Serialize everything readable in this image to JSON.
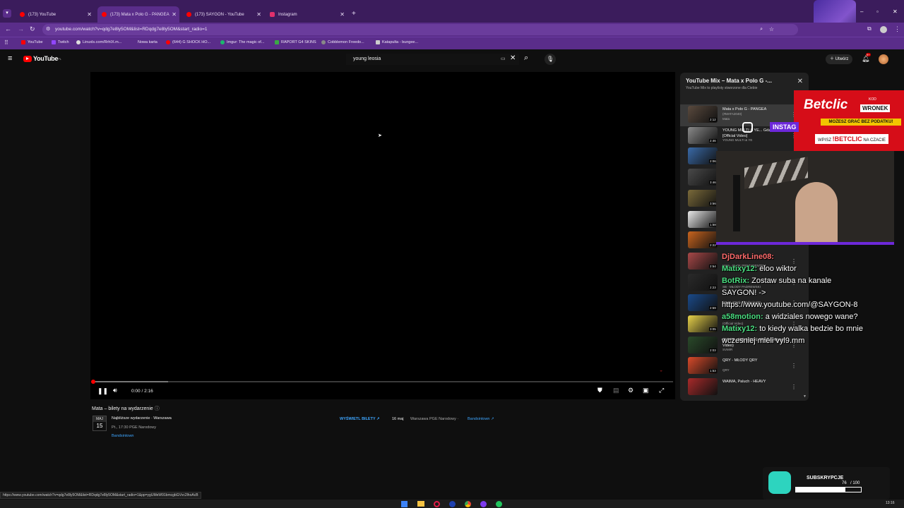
{
  "browser": {
    "tabs": [
      {
        "title": "(173) YouTube",
        "fav_color": "#ff0000"
      },
      {
        "title": "(173) Mata x Polo G - PANGEA",
        "fav_color": "#ff0000"
      },
      {
        "title": "(173) SAYGON - YouTube",
        "fav_color": "#ff0000"
      },
      {
        "title": "Instagram",
        "fav_color": "#e1306c"
      }
    ],
    "new_tab_label": "+",
    "url": "youtube.com/watch?v=qdg7e8ly5OM&list=RDqdg7e8ly5OM&start_radio=1",
    "bookmarks": [
      {
        "label": "YouTube",
        "color": "#ff0000"
      },
      {
        "label": "Twitch",
        "color": "#9146ff"
      },
      {
        "label": "Linuxls.com/RrhIX.m...",
        "color": "#dddddd"
      },
      {
        "label": "Nowa karta",
        "color": "#5a2d8a"
      },
      {
        "label": "(644) G SHOCK HO...",
        "color": "#ff0000"
      },
      {
        "label": "Imgur: The magic of...",
        "color": "#1bb76e"
      },
      {
        "label": "RAPORT G4 SKINS",
        "color": "#3aa845"
      },
      {
        "label": "Cobblemon Freedo...",
        "color": "#888888"
      },
      {
        "label": "Katapulta - bungee...",
        "color": "#cccccc"
      }
    ]
  },
  "youtube": {
    "logo_text": "YouTube",
    "logo_country": "PL",
    "search_value": "young leosia",
    "create_label": "Utwórz",
    "notif_count": "9+"
  },
  "player": {
    "time": "0:00 / 2:16",
    "progress": 0.0,
    "buffered": 0.13
  },
  "event": {
    "title": "Mata – bilety na wydarzenie",
    "month": "MAJ",
    "day": "15",
    "next_label": "Najbliższe wydarzenie · Warszawa",
    "next_detail": "Pt., 17:30 PGE Narodowy",
    "provider": "Bandsintown",
    "tickets_label": "WYŚWIETL BILETY",
    "row_date": "16 maj",
    "row_place": "Warszawa PGE Narodowy",
    "row_provider": "Bandsintown"
  },
  "playlist": {
    "title": "YouTube Mix – Mata x Polo G -...",
    "subtitle": "YouTube Mix to playlisty stworzone dla Ciebie",
    "items": [
      {
        "title": "Mata x Polo G - PANGEA",
        "sub": "(#MATA2040)",
        "author": "Mata",
        "dur": "2:12",
        "color": "#5a4a3e"
      },
      {
        "title": "YOUNG MULTI & YE... Gdzie dom? [Official Video]",
        "sub": "",
        "author": "YOUNG MULTI & YE",
        "dur": "2:46",
        "color": "#8a8a8a"
      },
      {
        "title": "",
        "sub": "",
        "author": "",
        "dur": "2:06",
        "color": "#3a6aa8"
      },
      {
        "title": "",
        "sub": "",
        "author": "",
        "dur": "3:46",
        "color": "#4a4a4a"
      },
      {
        "title": "",
        "sub": "",
        "author": "",
        "dur": "3:56",
        "color": "#7a6a3a"
      },
      {
        "title": "",
        "sub": "",
        "author": "",
        "dur": "1:58",
        "color": "#e8e8e8"
      },
      {
        "title": "",
        "sub": "",
        "author": "",
        "dur": "2:22",
        "color": "#c8641e"
      },
      {
        "title": "",
        "sub": "",
        "author": "Mata - BLOK PREZYDENTEM",
        "dur": "2:54",
        "color": "#a84848"
      },
      {
        "title": "",
        "sub": "",
        "author": "SB - MŁODY PADREWSKI",
        "dur": "2:23",
        "color": "#2a2a2a"
      },
      {
        "title": "",
        "sub": "(28.01.2022) #fundacja420",
        "author": "",
        "dur": "2:59",
        "color": "#1a4a8a"
      },
      {
        "title": "",
        "sub": "(Official Video)",
        "author": "Mata i Khaid",
        "dur": "3:05",
        "color": "#e8d24a"
      },
      {
        "title": "SVM!R - NIE MOGE SPAĆ (Official Video)",
        "sub": "",
        "author": "SVM!R",
        "dur": "2:03",
        "color": "#2a4a2a"
      },
      {
        "title": "QRY - MŁODY QRY",
        "sub": "",
        "author": "QRY",
        "dur": "1:53",
        "color": "#d84a2a"
      },
      {
        "title": "WAIMA, Paluch - HEAVY",
        "sub": "",
        "author": "",
        "dur": "",
        "color": "#a82a2a"
      }
    ]
  },
  "overlay": {
    "betclic_brand": "Betclic",
    "betclic_code_label": "KOD",
    "betclic_code": "WRONEK",
    "betclic_tagline": "MOŻESZ GRAĆ BEZ PODATKU!",
    "betclic_cta_prefix": "WPISZ",
    "betclic_cta_brand": "!BETCLIC",
    "betclic_cta_suffix": "NA CZACIE",
    "insta_label": "INSTAG",
    "chat": [
      {
        "user": "DjDarkLine08:",
        "msg": "",
        "color": "#ff6b6b"
      },
      {
        "user": "Matixy12:",
        "msg": "eloo wiktor",
        "color": "#4ade80"
      },
      {
        "user": "BotRix:",
        "msg": "Zostaw suba na kanale",
        "color": "#4ade80"
      },
      {
        "user": "",
        "msg": "SAYGON! ->",
        "color": "#ffffff"
      },
      {
        "user": "",
        "msg": "https://www.youtube.com/@SAYGON-8",
        "color": "#ffffff"
      },
      {
        "user": "a58motion:",
        "msg": "a widziales nowego wane?",
        "color": "#4ade80"
      },
      {
        "user": "Matixy12:",
        "msg": "to kiedy walka bedzie bo mnie",
        "color": "#4ade80"
      },
      {
        "user": "",
        "msg": "wczesniej mieli vyl9.mm",
        "color": "#ffffff"
      }
    ],
    "subs_label": "SUBSKRYPCJE",
    "subs_current": "76",
    "subs_goal": "/ 100",
    "subs_ratio": 0.76
  },
  "status_url": "https://www.youtube.com/watch?v=qdg7e8ly5OM&list=RDqdg7e8ly5OM&start_radio=1&pp=ygUMeW91bmcgbGVvc2lhoAcB",
  "clock": "13:16"
}
